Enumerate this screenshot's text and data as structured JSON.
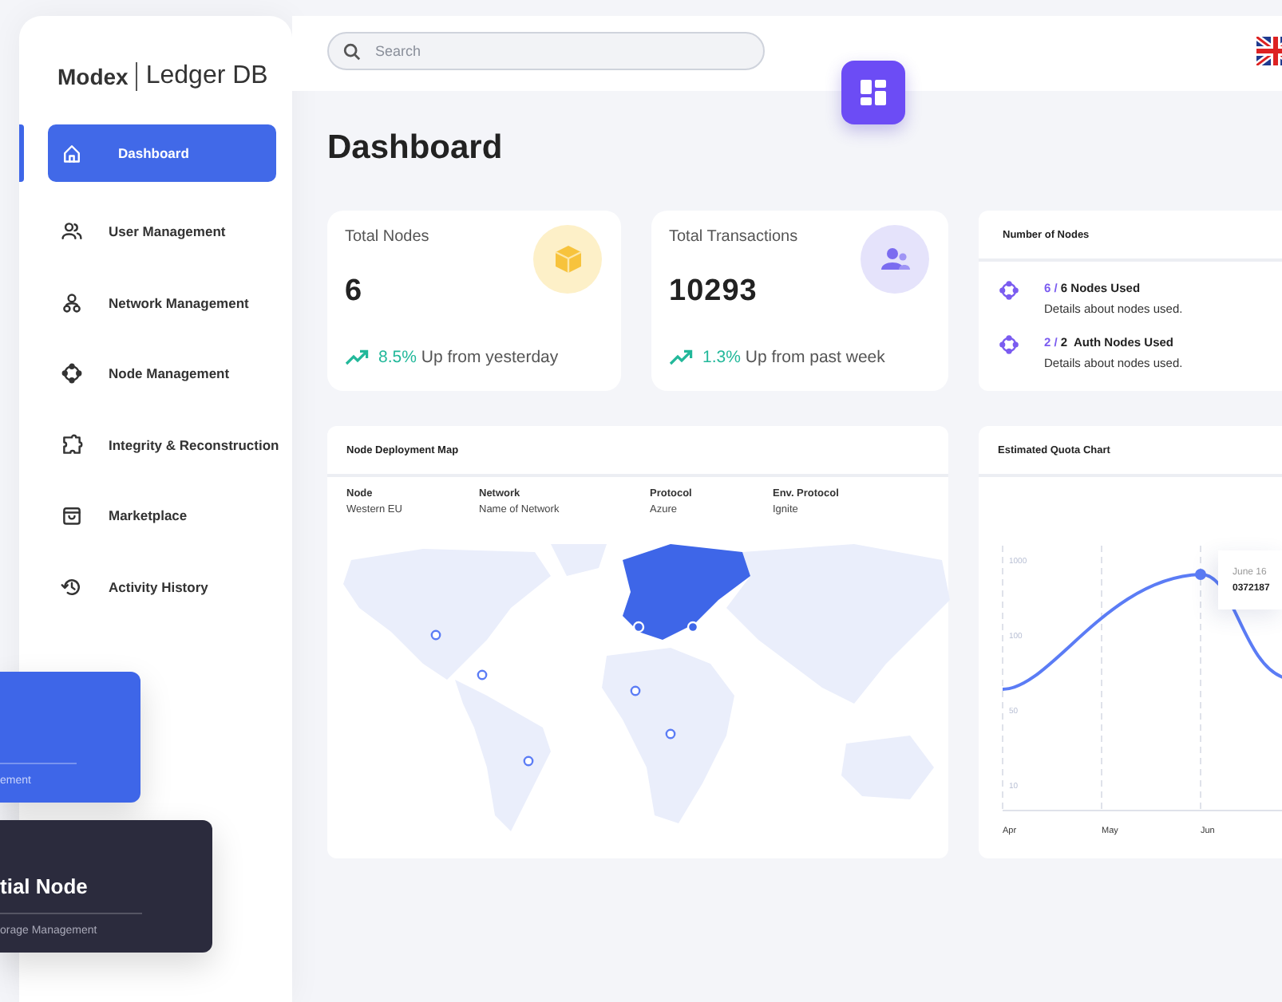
{
  "brand": {
    "logo": "Modex",
    "product": "Ledger DB"
  },
  "sidebar": {
    "items": [
      {
        "label": "Dashboard",
        "selected": true
      },
      {
        "label": "User Management",
        "selected": false
      },
      {
        "label": "Network Management",
        "selected": false
      },
      {
        "label": "Node Management",
        "selected": false
      },
      {
        "label": "Integrity & Reconstruction",
        "selected": false
      },
      {
        "label": "Marketplace",
        "selected": false
      },
      {
        "label": "Activity History",
        "selected": false
      }
    ]
  },
  "header": {
    "search": {
      "placeholder": "Search"
    }
  },
  "page_title": "Dashboard",
  "stats": [
    {
      "title": "Total Nodes",
      "value": "6",
      "change": "8.5%",
      "note": "Up from yesterday"
    },
    {
      "title": "Total Transactions",
      "value": "10293",
      "change": "1.3%",
      "note": "Up from past week"
    }
  ],
  "nodes_card": {
    "title": "Number of Nodes",
    "items": [
      {
        "count": "6 /",
        "label": "6 Nodes Used",
        "detail": "Details about nodes used."
      },
      {
        "count": "2 /",
        "label": "2  Auth Nodes Used",
        "detail": "Details about nodes used."
      }
    ]
  },
  "map_card": {
    "title": "Node Deployment Map",
    "columns": [
      {
        "heading": "Node",
        "value": "Western EU"
      },
      {
        "heading": "Network",
        "value": "Name of Network"
      },
      {
        "heading": "Protocol",
        "value": "Azure"
      },
      {
        "heading": "Env. Protocol",
        "value": "Ignite"
      }
    ]
  },
  "chart_card": {
    "title": "Estimated Quota Chart",
    "tooltip": {
      "date": "June 16",
      "value": "0372187"
    },
    "y_labels": [
      "1000",
      "100",
      "50",
      "10"
    ],
    "x_labels": [
      "Apr",
      "May",
      "Jun"
    ]
  },
  "promo_cards": [
    {
      "kind": "blue",
      "subtitle": "ement"
    },
    {
      "kind": "dark",
      "title": "tial Node",
      "subtitle": "orage Management"
    }
  ]
}
